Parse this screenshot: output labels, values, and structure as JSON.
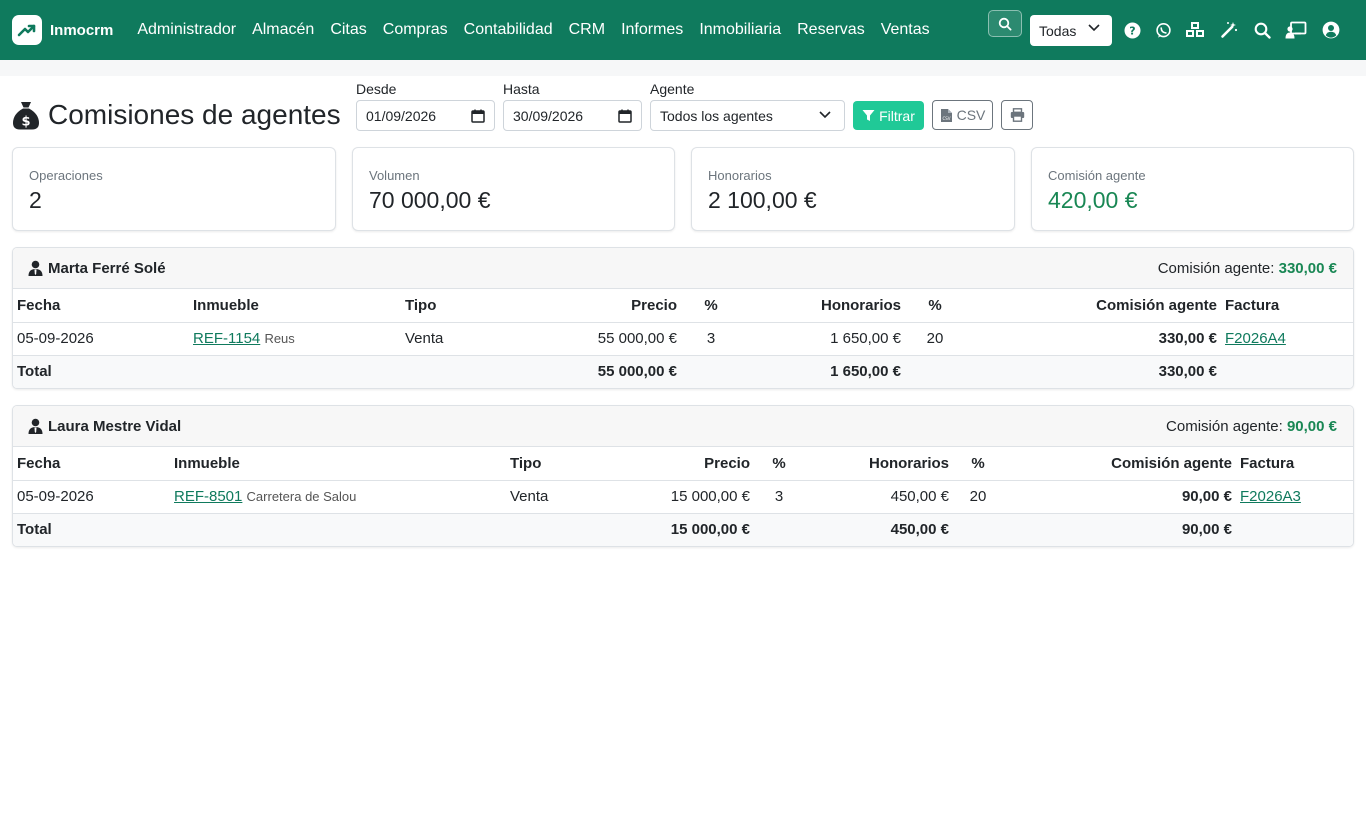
{
  "app": {
    "name": "Inmocrm"
  },
  "nav": {
    "items": [
      "Administrador",
      "Almacén",
      "Citas",
      "Compras",
      "Contabilidad",
      "CRM",
      "Informes",
      "Inmobiliaria",
      "Reservas",
      "Ventas"
    ],
    "scope_select": "Todas"
  },
  "page": {
    "title": "Comisiones de agentes"
  },
  "filters": {
    "from_label": "Desde",
    "from_value": "01/09/2026",
    "to_label": "Hasta",
    "to_value": "30/09/2026",
    "agent_label": "Agente",
    "agent_value": "Todos los agentes",
    "filter_button": "Filtrar",
    "csv_button": "CSV"
  },
  "stats": {
    "operaciones_label": "Operaciones",
    "operaciones_value": "2",
    "volumen_label": "Volumen",
    "volumen_value": "70 000,00 €",
    "honorarios_label": "Honorarios",
    "honorarios_value": "2 100,00 €",
    "comision_label": "Comisión agente",
    "comision_value": "420,00 €"
  },
  "columns": {
    "fecha": "Fecha",
    "inmueble": "Inmueble",
    "tipo": "Tipo",
    "precio": "Precio",
    "pct": "%",
    "honorarios": "Honorarios",
    "pct2": "%",
    "comision": "Comisión agente",
    "factura": "Factura"
  },
  "commission_label": "Comisión agente:",
  "agents": [
    {
      "name": "Marta Ferré Solé",
      "commission": "330,00 €",
      "rows": [
        {
          "fecha": "05-09-2026",
          "ref": "REF-1154",
          "location": "Reus",
          "tipo": "Venta",
          "precio": "55 000,00 €",
          "pct": "3",
          "honorarios": "1 650,00 €",
          "pct2": "20",
          "comision": "330,00 €",
          "factura": "F2026A4"
        }
      ],
      "total_label": "Total",
      "total_precio": "55 000,00 €",
      "total_honorarios": "1 650,00 €",
      "total_comision": "330,00 €"
    },
    {
      "name": "Laura Mestre Vidal",
      "commission": "90,00 €",
      "rows": [
        {
          "fecha": "05-09-2026",
          "ref": "REF-8501",
          "location": "Carretera de Salou",
          "tipo": "Venta",
          "precio": "15 000,00 €",
          "pct": "3",
          "honorarios": "450,00 €",
          "pct2": "20",
          "comision": "90,00 €",
          "factura": "F2026A3"
        }
      ],
      "total_label": "Total",
      "total_precio": "15 000,00 €",
      "total_honorarios": "450,00 €",
      "total_comision": "90,00 €"
    }
  ],
  "colors": {
    "brand": "#0f7a5d",
    "accent": "#20c997",
    "positive": "#198754"
  },
  "icons": [
    "trend-up-icon",
    "search-icon",
    "chevron-down-icon",
    "help-icon",
    "whatsapp-icon",
    "cubes-icon",
    "magic-wand-icon",
    "user-chalkboard-icon",
    "user-circle-icon",
    "money-bag-icon",
    "calendar-icon",
    "filter-icon",
    "file-csv-icon",
    "print-icon",
    "user-tie-icon"
  ]
}
